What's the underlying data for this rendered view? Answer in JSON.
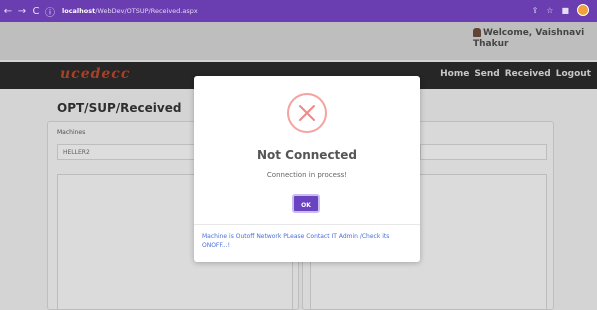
{
  "browser": {
    "back": "←",
    "forward": "→",
    "reload": "C",
    "info": "ⓘ",
    "url_host": "localhost",
    "url_path": "/WebDev/OTSUP/Received.aspx",
    "icons": [
      "share-icon",
      "star-icon",
      "extensions-icon",
      "profile-avatar"
    ]
  },
  "header": {
    "welcome": "Welcome, Vaishnavi Thakur"
  },
  "navbar": {
    "logo": "ucedecc",
    "links": [
      "Home",
      "Send",
      "Received",
      "Logout"
    ]
  },
  "page": {
    "title": "OPT/SUP/Received",
    "machines_label": "Machines",
    "machine_value": "HELLER2"
  },
  "modal": {
    "icon": "error-x-icon",
    "title": "Not Connected",
    "text": "Connection in process!",
    "ok_label": "OK",
    "footer": "Machine is Outoff Network PLease Contact IT Admin /Check its ONOFF...!"
  },
  "colors": {
    "browser_bar": "#6a3db0",
    "navbar": "#2a2a2a",
    "ok_button": "#6a44c0",
    "error_circle": "#f3a3a0",
    "footer_text": "#4a6fd6"
  }
}
